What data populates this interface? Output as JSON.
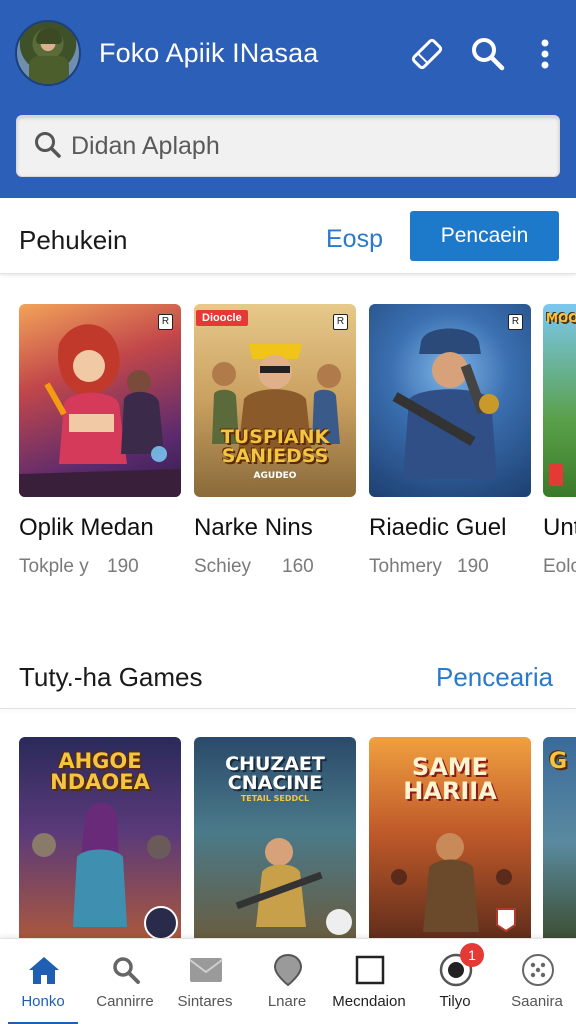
{
  "header": {
    "title": "Foko Apiik INasaa",
    "icons": [
      "ticket-icon",
      "search-icon",
      "more-vertical-icon"
    ]
  },
  "search": {
    "placeholder": "Didan Aplaph"
  },
  "section1": {
    "title": "Pehukein",
    "link": "Eosp",
    "button": "Pencaein",
    "cards": [
      {
        "title": "Oplik Medan",
        "sub": "Tokple y",
        "num": "190"
      },
      {
        "title": "Narke Nins",
        "sub": "Schiey",
        "num": "160",
        "tag": "Dioocle",
        "art": "TUSPIANK SANIEDSS",
        "art_sub": "AGUDEO"
      },
      {
        "title": "Riaedic Guel",
        "sub": "Tohmery",
        "num": "190"
      },
      {
        "title": "Unt",
        "sub": "Eolo",
        "num": "",
        "art": "MOON"
      }
    ]
  },
  "section2": {
    "title": "Tuty.-ha Games",
    "link": "Pencearia",
    "cards": [
      {
        "art": "AHGOE NDAOEA"
      },
      {
        "art": "CHUZAET CNACINE",
        "art_sub": "TETAIL SEDDCL"
      },
      {
        "art": "SAME HARIIA"
      },
      {
        "art": "G"
      }
    ]
  },
  "bottom_nav": [
    {
      "label": "Honko",
      "icon": "home-icon",
      "active": true
    },
    {
      "label": "Cannirre",
      "icon": "search-icon"
    },
    {
      "label": "Sintares",
      "icon": "mail-icon"
    },
    {
      "label": "Lnare",
      "icon": "map-pin-icon"
    },
    {
      "label": "Mecndaion",
      "icon": "square-icon"
    },
    {
      "label": "Tilyo",
      "icon": "record-icon",
      "badge": "1"
    },
    {
      "label": "Saanira",
      "icon": "dots-circle-icon"
    }
  ],
  "colors": {
    "header_bg": "#2c5fb8",
    "accent": "#1d79c9",
    "link": "#2b79c9",
    "badge": "#e53935"
  }
}
